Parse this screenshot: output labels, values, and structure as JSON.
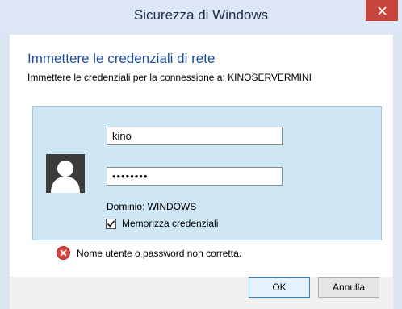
{
  "window": {
    "title": "Sicurezza di Windows",
    "close_icon": "close-icon"
  },
  "dialog": {
    "heading": "Immettere le credenziali di rete",
    "subheading": "Immettere le credenziali per la connessione a: KINOSERVERMINI"
  },
  "credentials": {
    "avatar_icon": "user-avatar-icon",
    "username": "kino",
    "password_mask": "••••••••",
    "domain_label": "Dominio: WINDOWS",
    "remember_label": "Memorizza credenziali",
    "remember_checked": true
  },
  "error": {
    "icon": "error-icon",
    "message": "Nome utente o password non corretta."
  },
  "buttons": {
    "ok_label": "OK",
    "cancel_label": "Annulla"
  },
  "colors": {
    "heading": "#1b4f9c",
    "credential_panel": "#cfe7f5",
    "close_button": "#c7443a",
    "error_icon": "#d9453d"
  }
}
